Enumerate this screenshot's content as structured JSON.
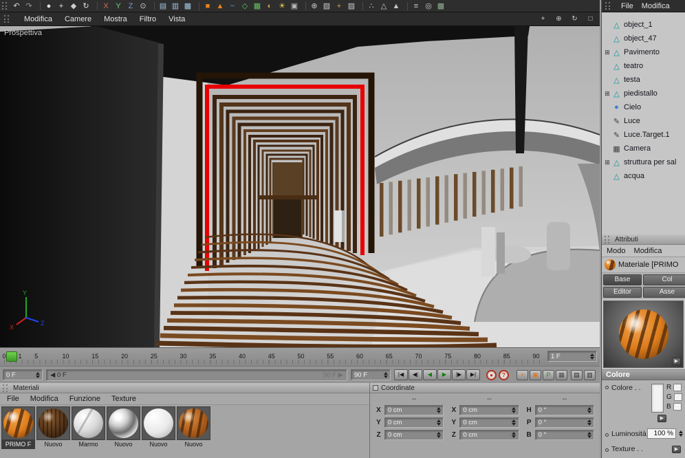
{
  "top_toolbar": {
    "icons": [
      {
        "name": "undo-icon",
        "glyph": "↶",
        "color": "#d8d8d8"
      },
      {
        "name": "redo-icon",
        "glyph": "↷",
        "color": "#969696"
      },
      {
        "sep": true
      },
      {
        "name": "live-selection-icon",
        "glyph": "●",
        "color": "#e0e0e0"
      },
      {
        "name": "move-tool-icon",
        "glyph": "+",
        "color": "#e8e8e8"
      },
      {
        "name": "scale-tool-icon",
        "glyph": "◆",
        "color": "#cfcfcf"
      },
      {
        "name": "rotate-tool-icon",
        "glyph": "↻",
        "color": "#e0e0e0"
      },
      {
        "sep": true
      },
      {
        "name": "lock-x-axis-icon",
        "glyph": "X",
        "color": "#d66a5a"
      },
      {
        "name": "lock-y-axis-icon",
        "glyph": "Y",
        "color": "#72d072"
      },
      {
        "name": "lock-z-axis-icon",
        "glyph": "Z",
        "color": "#7a96da"
      },
      {
        "name": "coordinate-system-icon",
        "glyph": "⊙",
        "color": "#cccccc"
      },
      {
        "sep": true
      },
      {
        "name": "render-view-icon",
        "glyph": "▤",
        "color": "#9fc3de"
      },
      {
        "name": "render-active-view-icon",
        "glyph": "▥",
        "color": "#9fc3de"
      },
      {
        "name": "render-settings-icon",
        "glyph": "▩",
        "color": "#9fc3de"
      },
      {
        "sep": true
      },
      {
        "name": "add-cube-icon",
        "glyph": "■",
        "color": "#e8821e"
      },
      {
        "name": "add-primitive-icon",
        "glyph": "▲",
        "color": "#e8821e"
      },
      {
        "name": "add-spline-icon",
        "glyph": "~",
        "color": "#62a8dc"
      },
      {
        "name": "add-nurbs-icon",
        "glyph": "◇",
        "color": "#62c462"
      },
      {
        "name": "add-array-icon",
        "glyph": "▦",
        "color": "#62c462"
      },
      {
        "name": "add-boole-icon",
        "glyph": "◐",
        "color": "#caa24a"
      },
      {
        "name": "add-light-icon",
        "glyph": "☀",
        "color": "#e8d24a"
      },
      {
        "name": "add-camera-icon",
        "glyph": "▣",
        "color": "#b8b8b8"
      },
      {
        "sep": true
      },
      {
        "name": "snap-settings-icon",
        "glyph": "⊕",
        "color": "#c8c8c8"
      },
      {
        "name": "workplane-icon",
        "glyph": "▧",
        "color": "#c8c8c8"
      },
      {
        "name": "object-axis-icon",
        "glyph": "+",
        "color": "#e0a040"
      },
      {
        "name": "texture-mode-icon",
        "glyph": "▨",
        "color": "#c8c8c8"
      },
      {
        "sep": true
      },
      {
        "name": "points-mode-icon",
        "glyph": "∴",
        "color": "#c8c8c8"
      },
      {
        "name": "edges-mode-icon",
        "glyph": "△",
        "color": "#c8c8c8"
      },
      {
        "name": "polygons-mode-icon",
        "glyph": "▲",
        "color": "#c8c8c8"
      },
      {
        "sep": true
      },
      {
        "name": "isoline-icon",
        "glyph": "≡",
        "color": "#c8c8c8"
      },
      {
        "name": "viewport-solo-icon",
        "glyph": "◎",
        "color": "#c8c8c8"
      },
      {
        "name": "enhanced-display-icon",
        "glyph": "▩",
        "color": "#8fae8f"
      }
    ]
  },
  "viewport_menubar": {
    "items": [
      "Modifica",
      "Camere",
      "Mostra",
      "Filtro",
      "Vista"
    ],
    "view_icons": [
      {
        "name": "pan-view-icon",
        "glyph": "+"
      },
      {
        "name": "zoom-view-icon",
        "glyph": "⊕"
      },
      {
        "name": "rotate-view-icon",
        "glyph": "↻"
      },
      {
        "name": "maximize-view-icon",
        "glyph": "□"
      }
    ]
  },
  "viewport": {
    "label": "Prospettiva",
    "axis": {
      "x": "X",
      "y": "Y",
      "z": "Z"
    }
  },
  "timeline": {
    "ticks": [
      0,
      1,
      5,
      10,
      15,
      20,
      25,
      30,
      35,
      40,
      45,
      50,
      55,
      60,
      65,
      70,
      75,
      80,
      85,
      90
    ],
    "frame_field": "1 F"
  },
  "transport": {
    "current_start": "0 F",
    "range_left": "0 F",
    "range_right": "90 F",
    "end_frame": "90 F",
    "buttons": [
      {
        "name": "goto-start-button",
        "glyph": "|◀"
      },
      {
        "name": "prev-frame-button",
        "glyph": "◀|"
      },
      {
        "name": "play-backward-button",
        "glyph": "◀",
        "accent": true
      },
      {
        "name": "play-forward-button",
        "glyph": "▶",
        "accent": true
      },
      {
        "name": "next-frame-button",
        "glyph": "|▶"
      },
      {
        "name": "goto-end-button",
        "glyph": "▶|"
      }
    ],
    "record_buttons": [
      {
        "name": "record-keyframe-button",
        "glyph": "●"
      },
      {
        "name": "autokey-button",
        "glyph": "?"
      }
    ],
    "key_buttons": [
      {
        "name": "record-position-icon",
        "glyph": "+",
        "color": "#e07820"
      },
      {
        "name": "record-scale-icon",
        "glyph": "▣",
        "color": "#e07820"
      },
      {
        "name": "record-parameter-icon",
        "glyph": "P",
        "color": "#2f8f2f"
      },
      {
        "name": "record-pla-icon",
        "glyph": "▦",
        "color": "#4a4a4a"
      }
    ],
    "panel_buttons": [
      {
        "name": "timeline-window-icon",
        "glyph": "▤"
      },
      {
        "name": "fcurve-window-icon",
        "glyph": "▥"
      }
    ]
  },
  "materials_panel": {
    "title": "Materiali",
    "menu": [
      "File",
      "Modifica",
      "Funzione",
      "Texture"
    ],
    "materials": [
      {
        "label": "PRIMO F",
        "style": "primo",
        "selected": true
      },
      {
        "label": "Nuovo",
        "style": "wood-dark"
      },
      {
        "label": "Marmo",
        "style": "marble"
      },
      {
        "label": "Nuovo",
        "style": "chrome"
      },
      {
        "label": "Nuovo",
        "style": "white"
      },
      {
        "label": "Nuovo",
        "style": "wood-orange"
      }
    ]
  },
  "coordinates_panel": {
    "title": "Coordinate",
    "column_headers": [
      "--",
      "--",
      "--"
    ],
    "rows": [
      {
        "cells": [
          {
            "label": "X",
            "value": "0 cm"
          },
          {
            "label": "X",
            "value": "0 cm"
          },
          {
            "label": "H",
            "value": "0 °"
          }
        ]
      },
      {
        "cells": [
          {
            "label": "Y",
            "value": "0 cm"
          },
          {
            "label": "Y",
            "value": "0 cm"
          },
          {
            "label": "P",
            "value": "0 °"
          }
        ]
      },
      {
        "cells": [
          {
            "label": "Z",
            "value": "0 cm"
          },
          {
            "label": "Z",
            "value": "0 cm"
          },
          {
            "label": "B",
            "value": "0 °"
          }
        ]
      }
    ]
  },
  "object_manager": {
    "menu": [
      "File",
      "Modifica"
    ],
    "expand_glyph": "⊞",
    "icon_glyphs": {
      "polygon": {
        "glyph": "△",
        "color": "#0e8f99"
      },
      "sky": {
        "glyph": "●",
        "color": "#3a7fd5"
      },
      "light": {
        "glyph": "✎",
        "color": "#3c3c3c"
      },
      "camera": {
        "glyph": "▦",
        "color": "#3e3e44"
      }
    },
    "objects": [
      {
        "name": "object_1",
        "icon": "polygon"
      },
      {
        "name": "object_47",
        "icon": "polygon"
      },
      {
        "name": "Pavimento",
        "icon": "polygon",
        "expandable": true
      },
      {
        "name": "teatro",
        "icon": "polygon"
      },
      {
        "name": "testa",
        "icon": "polygon"
      },
      {
        "name": "piedistallo",
        "icon": "polygon",
        "expandable": true
      },
      {
        "name": "Cielo",
        "icon": "sky"
      },
      {
        "name": "Luce",
        "icon": "light"
      },
      {
        "name": "Luce.Target.1",
        "icon": "light"
      },
      {
        "name": "Camera",
        "icon": "camera"
      },
      {
        "name": "struttura per sal",
        "icon": "polygon",
        "expandable": true
      },
      {
        "name": "acqua",
        "icon": "polygon"
      }
    ]
  },
  "attributes_panel": {
    "title": "Attributi",
    "menu": [
      "Modo",
      "Modifica"
    ],
    "material_label": "Materiale [PRIMO",
    "tabs": [
      "Base",
      "Col",
      "Editor",
      "Asse"
    ]
  },
  "color_panel": {
    "title": "Colore",
    "color_label": "Colore . .",
    "channels": [
      "R",
      "G",
      "B"
    ],
    "luminosity_label": "Luminosità",
    "luminosity_value": "100 %",
    "texture_label": "Texture . ."
  },
  "colors": {
    "accent_red": "#e80000",
    "wood_dark": "#3c2412",
    "wood_mid": "#5c3a1e",
    "marker_green": "#4db32e"
  }
}
